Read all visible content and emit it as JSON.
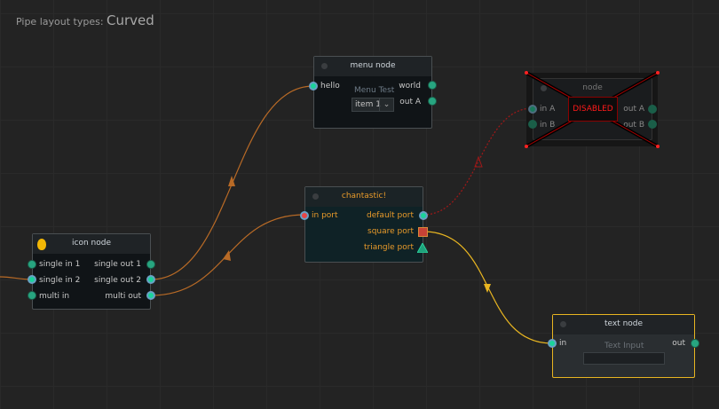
{
  "header": {
    "prefix": "Pipe layout types:",
    "value": "Curved"
  },
  "menu_node": {
    "title": "menu node",
    "inputs": [
      "hello"
    ],
    "outputs": [
      "world",
      "out A"
    ],
    "menu_label": "Menu Test",
    "menu_value": "item 1"
  },
  "disabled_node": {
    "title": "node",
    "inputs": [
      "in A",
      "in B"
    ],
    "outputs": [
      "out A",
      "out B"
    ],
    "badge": "DISABLED"
  },
  "chantastic_node": {
    "title": "chantastic!",
    "inputs": [
      "in port"
    ],
    "outputs": [
      "default port",
      "square port",
      "triangle port"
    ]
  },
  "icon_node": {
    "title": "icon node",
    "icon": "pear-icon",
    "inputs": [
      "single in 1",
      "single in 2",
      "multi in"
    ],
    "outputs": [
      "single out 1",
      "single out 2",
      "multi out"
    ]
  },
  "text_node": {
    "title": "text node",
    "inputs": [
      "in"
    ],
    "outputs": [
      "out"
    ],
    "input_label": "Text Input",
    "input_value": ""
  },
  "colors": {
    "pipe_orange": "#b86a26",
    "pipe_red": "#a01818",
    "pipe_yellow": "#e8b521",
    "accent_orange": "#e89a2a",
    "disabled": "#ff1a1a"
  }
}
